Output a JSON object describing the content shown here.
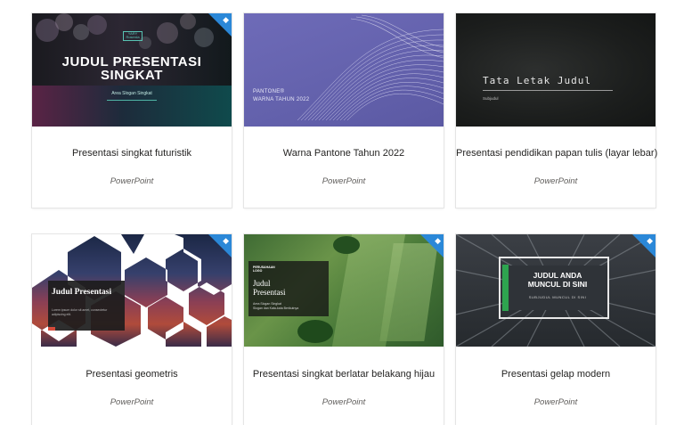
{
  "templates": [
    {
      "title": "Presentasi singkat futuristik",
      "app": "PowerPoint",
      "premium": true,
      "thumbnail": {
        "logo": "YARY Roserda",
        "heading_line1": "JUDUL PRESENTASI",
        "heading_line2": "SINGKAT",
        "subtitle": "Area Slogan Singkat"
      }
    },
    {
      "title": "Warna Pantone Tahun 2022",
      "app": "PowerPoint",
      "premium": false,
      "thumbnail": {
        "line1": "PANTONE®",
        "line2": "WARNA TAHUN 2022"
      }
    },
    {
      "title": "Presentasi pendidikan papan tulis (layar lebar)",
      "app": "PowerPoint",
      "premium": false,
      "thumbnail": {
        "heading": "Tata Letak Judul",
        "subtitle": "Subjudul"
      }
    },
    {
      "title": "Presentasi geometris",
      "app": "PowerPoint",
      "premium": true,
      "thumbnail": {
        "heading": "Judul Presentasi",
        "body": "Lorem ipsum dolor sit amet, consectetur adipiscing elit."
      }
    },
    {
      "title": "Presentasi singkat berlatar belakang hijau",
      "app": "PowerPoint",
      "premium": true,
      "thumbnail": {
        "logo_line1": "PERUSAHAAN",
        "logo_line2": "LOGO",
        "heading_line1": "Judul",
        "heading_line2": "Presentasi",
        "sub_line1": "Area Slogan Singkat",
        "sub_line2": "Slogan dan Kata-kata Berikutnya"
      }
    },
    {
      "title": "Presentasi gelap modern",
      "app": "PowerPoint",
      "premium": true,
      "thumbnail": {
        "heading_line1": "JUDUL ANDA",
        "heading_line2": "MUNCUL DI SINI",
        "subtitle": "SUBJUDUL MUNCUL DI SINI"
      }
    }
  ],
  "icons": {
    "premium": "diamond-icon"
  },
  "colors": {
    "premium_badge": "#2b88d8",
    "title_text": "#252423",
    "app_text": "#605e5c"
  }
}
